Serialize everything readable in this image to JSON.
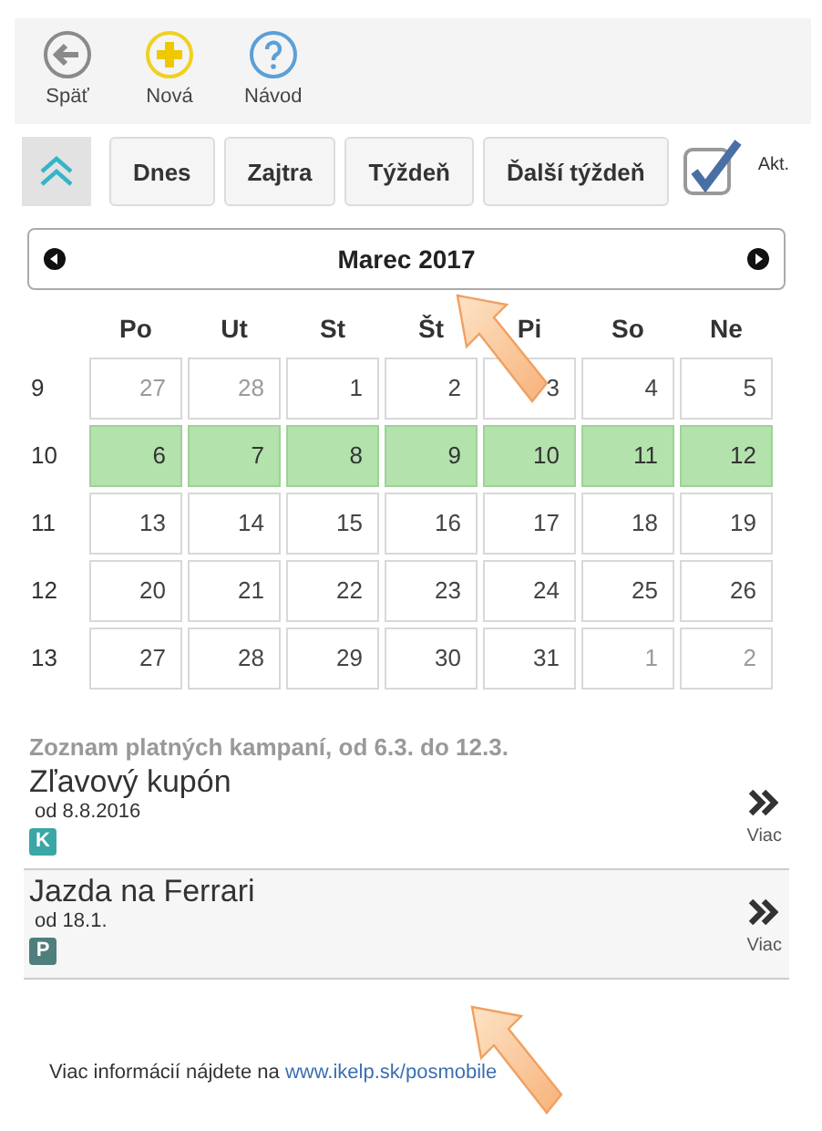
{
  "toolbar": [
    {
      "kind": "back",
      "label": "Späť"
    },
    {
      "kind": "new",
      "label": "Nová"
    },
    {
      "kind": "help",
      "label": "Návod"
    }
  ],
  "filter_bar": {
    "buttons": [
      "Dnes",
      "Zajtra",
      "Týždeň",
      "Ďalší týždeň"
    ],
    "active_only": {
      "label": "Akt.",
      "checked": true
    }
  },
  "calendar": {
    "month": "Marec 2017",
    "weekdays": [
      "Po",
      "Ut",
      "St",
      "Št",
      "Pi",
      "So",
      "Ne"
    ],
    "weeks": [
      {
        "number": "9",
        "selected": false,
        "days": [
          {
            "day": "27",
            "other_month": true
          },
          {
            "day": "28",
            "other_month": true
          },
          {
            "day": "1",
            "other_month": false
          },
          {
            "day": "2",
            "other_month": false
          },
          {
            "day": "3",
            "other_month": false
          },
          {
            "day": "4",
            "other_month": false
          },
          {
            "day": "5",
            "other_month": false
          }
        ]
      },
      {
        "number": "10",
        "selected": true,
        "days": [
          {
            "day": "6",
            "other_month": false
          },
          {
            "day": "7",
            "other_month": false
          },
          {
            "day": "8",
            "other_month": false
          },
          {
            "day": "9",
            "other_month": false
          },
          {
            "day": "10",
            "other_month": false
          },
          {
            "day": "11",
            "other_month": false
          },
          {
            "day": "12",
            "other_month": false
          }
        ]
      },
      {
        "number": "11",
        "selected": false,
        "days": [
          {
            "day": "13",
            "other_month": false
          },
          {
            "day": "14",
            "other_month": false
          },
          {
            "day": "15",
            "other_month": false
          },
          {
            "day": "16",
            "other_month": false
          },
          {
            "day": "17",
            "other_month": false
          },
          {
            "day": "18",
            "other_month": false
          },
          {
            "day": "19",
            "other_month": false
          }
        ]
      },
      {
        "number": "12",
        "selected": false,
        "days": [
          {
            "day": "20",
            "other_month": false
          },
          {
            "day": "21",
            "other_month": false
          },
          {
            "day": "22",
            "other_month": false
          },
          {
            "day": "23",
            "other_month": false
          },
          {
            "day": "24",
            "other_month": false
          },
          {
            "day": "25",
            "other_month": false
          },
          {
            "day": "26",
            "other_month": false
          }
        ]
      },
      {
        "number": "13",
        "selected": false,
        "days": [
          {
            "day": "27",
            "other_month": false
          },
          {
            "day": "28",
            "other_month": false
          },
          {
            "day": "29",
            "other_month": false
          },
          {
            "day": "30",
            "other_month": false
          },
          {
            "day": "31",
            "other_month": false
          },
          {
            "day": "1",
            "other_month": true
          },
          {
            "day": "2",
            "other_month": true
          }
        ]
      }
    ]
  },
  "campaigns": {
    "heading": "Zoznam platných kampaní, od 6.3. do 12.3.",
    "items": [
      {
        "title": "Zľavový kupón",
        "validity": "od 8.8.2016",
        "badge": "K",
        "color": "#3aa6a6",
        "more": "Viac"
      },
      {
        "title": "Jazda na Ferrari",
        "validity": "od 18.1.",
        "badge": "P",
        "color": "#4f7f7c",
        "more": "Viac"
      }
    ]
  },
  "footer": {
    "text": "Viac informácií nájdete na",
    "link": "www.ikelp.sk/posmobile"
  },
  "annotations": [
    {
      "kind": "arrow"
    },
    {
      "kind": "arrow"
    }
  ]
}
